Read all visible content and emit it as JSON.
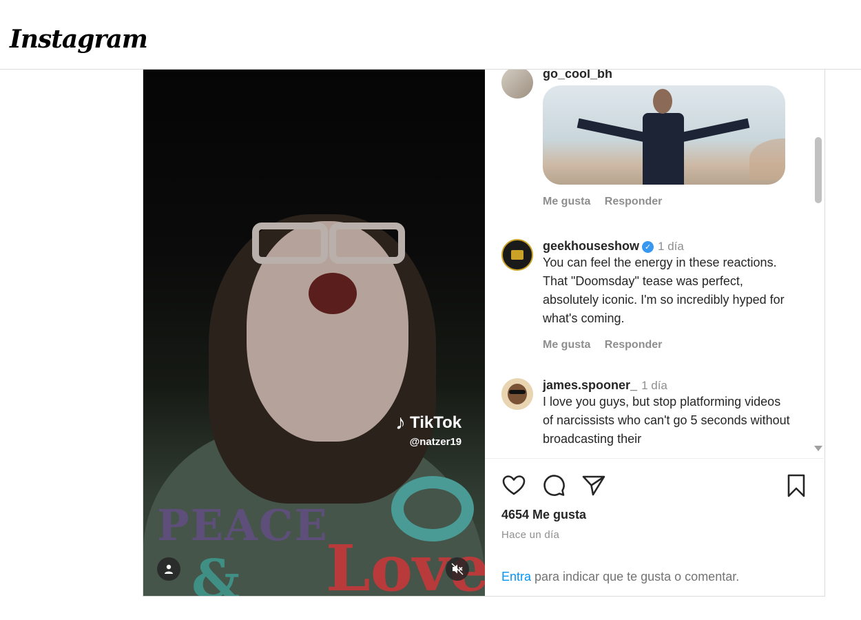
{
  "app": {
    "logo": "Instagram"
  },
  "media": {
    "shirt_text": "PEACE",
    "shirt_amp": "&",
    "shirt_love": "Love",
    "tiktok_brand": "TikTok",
    "tiktok_handle": "@natzer19",
    "user_tag_icon": "person-icon",
    "mute_icon": "speaker-muted-icon"
  },
  "comments": [
    {
      "username": "go_cool_bh",
      "time": "",
      "text": "",
      "has_gif": true,
      "like_label": "Me gusta",
      "reply_label": "Responder"
    },
    {
      "username": "geekhouseshow",
      "verified": true,
      "time": "1 día",
      "text": "You can feel the energy in these reactions. That \"Doomsday\" tease was perfect, absolutely iconic. I'm so incredibly hyped for what's coming.",
      "like_label": "Me gusta",
      "reply_label": "Responder"
    },
    {
      "username": "james.spooner_",
      "time": "1 día",
      "text": "I love you guys, but stop platforming videos of narcissists who can't go 5 seconds without broadcasting their",
      "like_label": "",
      "reply_label": ""
    }
  ],
  "actions": {
    "like_icon": "heart-icon",
    "comment_icon": "comment-bubble-icon",
    "share_icon": "paper-plane-icon",
    "save_icon": "bookmark-icon"
  },
  "likes": {
    "label": "4654 Me gusta"
  },
  "post_time": "Hace un día",
  "login_prompt": {
    "link": "Entra",
    "text": " para indicar que te gusta o comentar."
  }
}
